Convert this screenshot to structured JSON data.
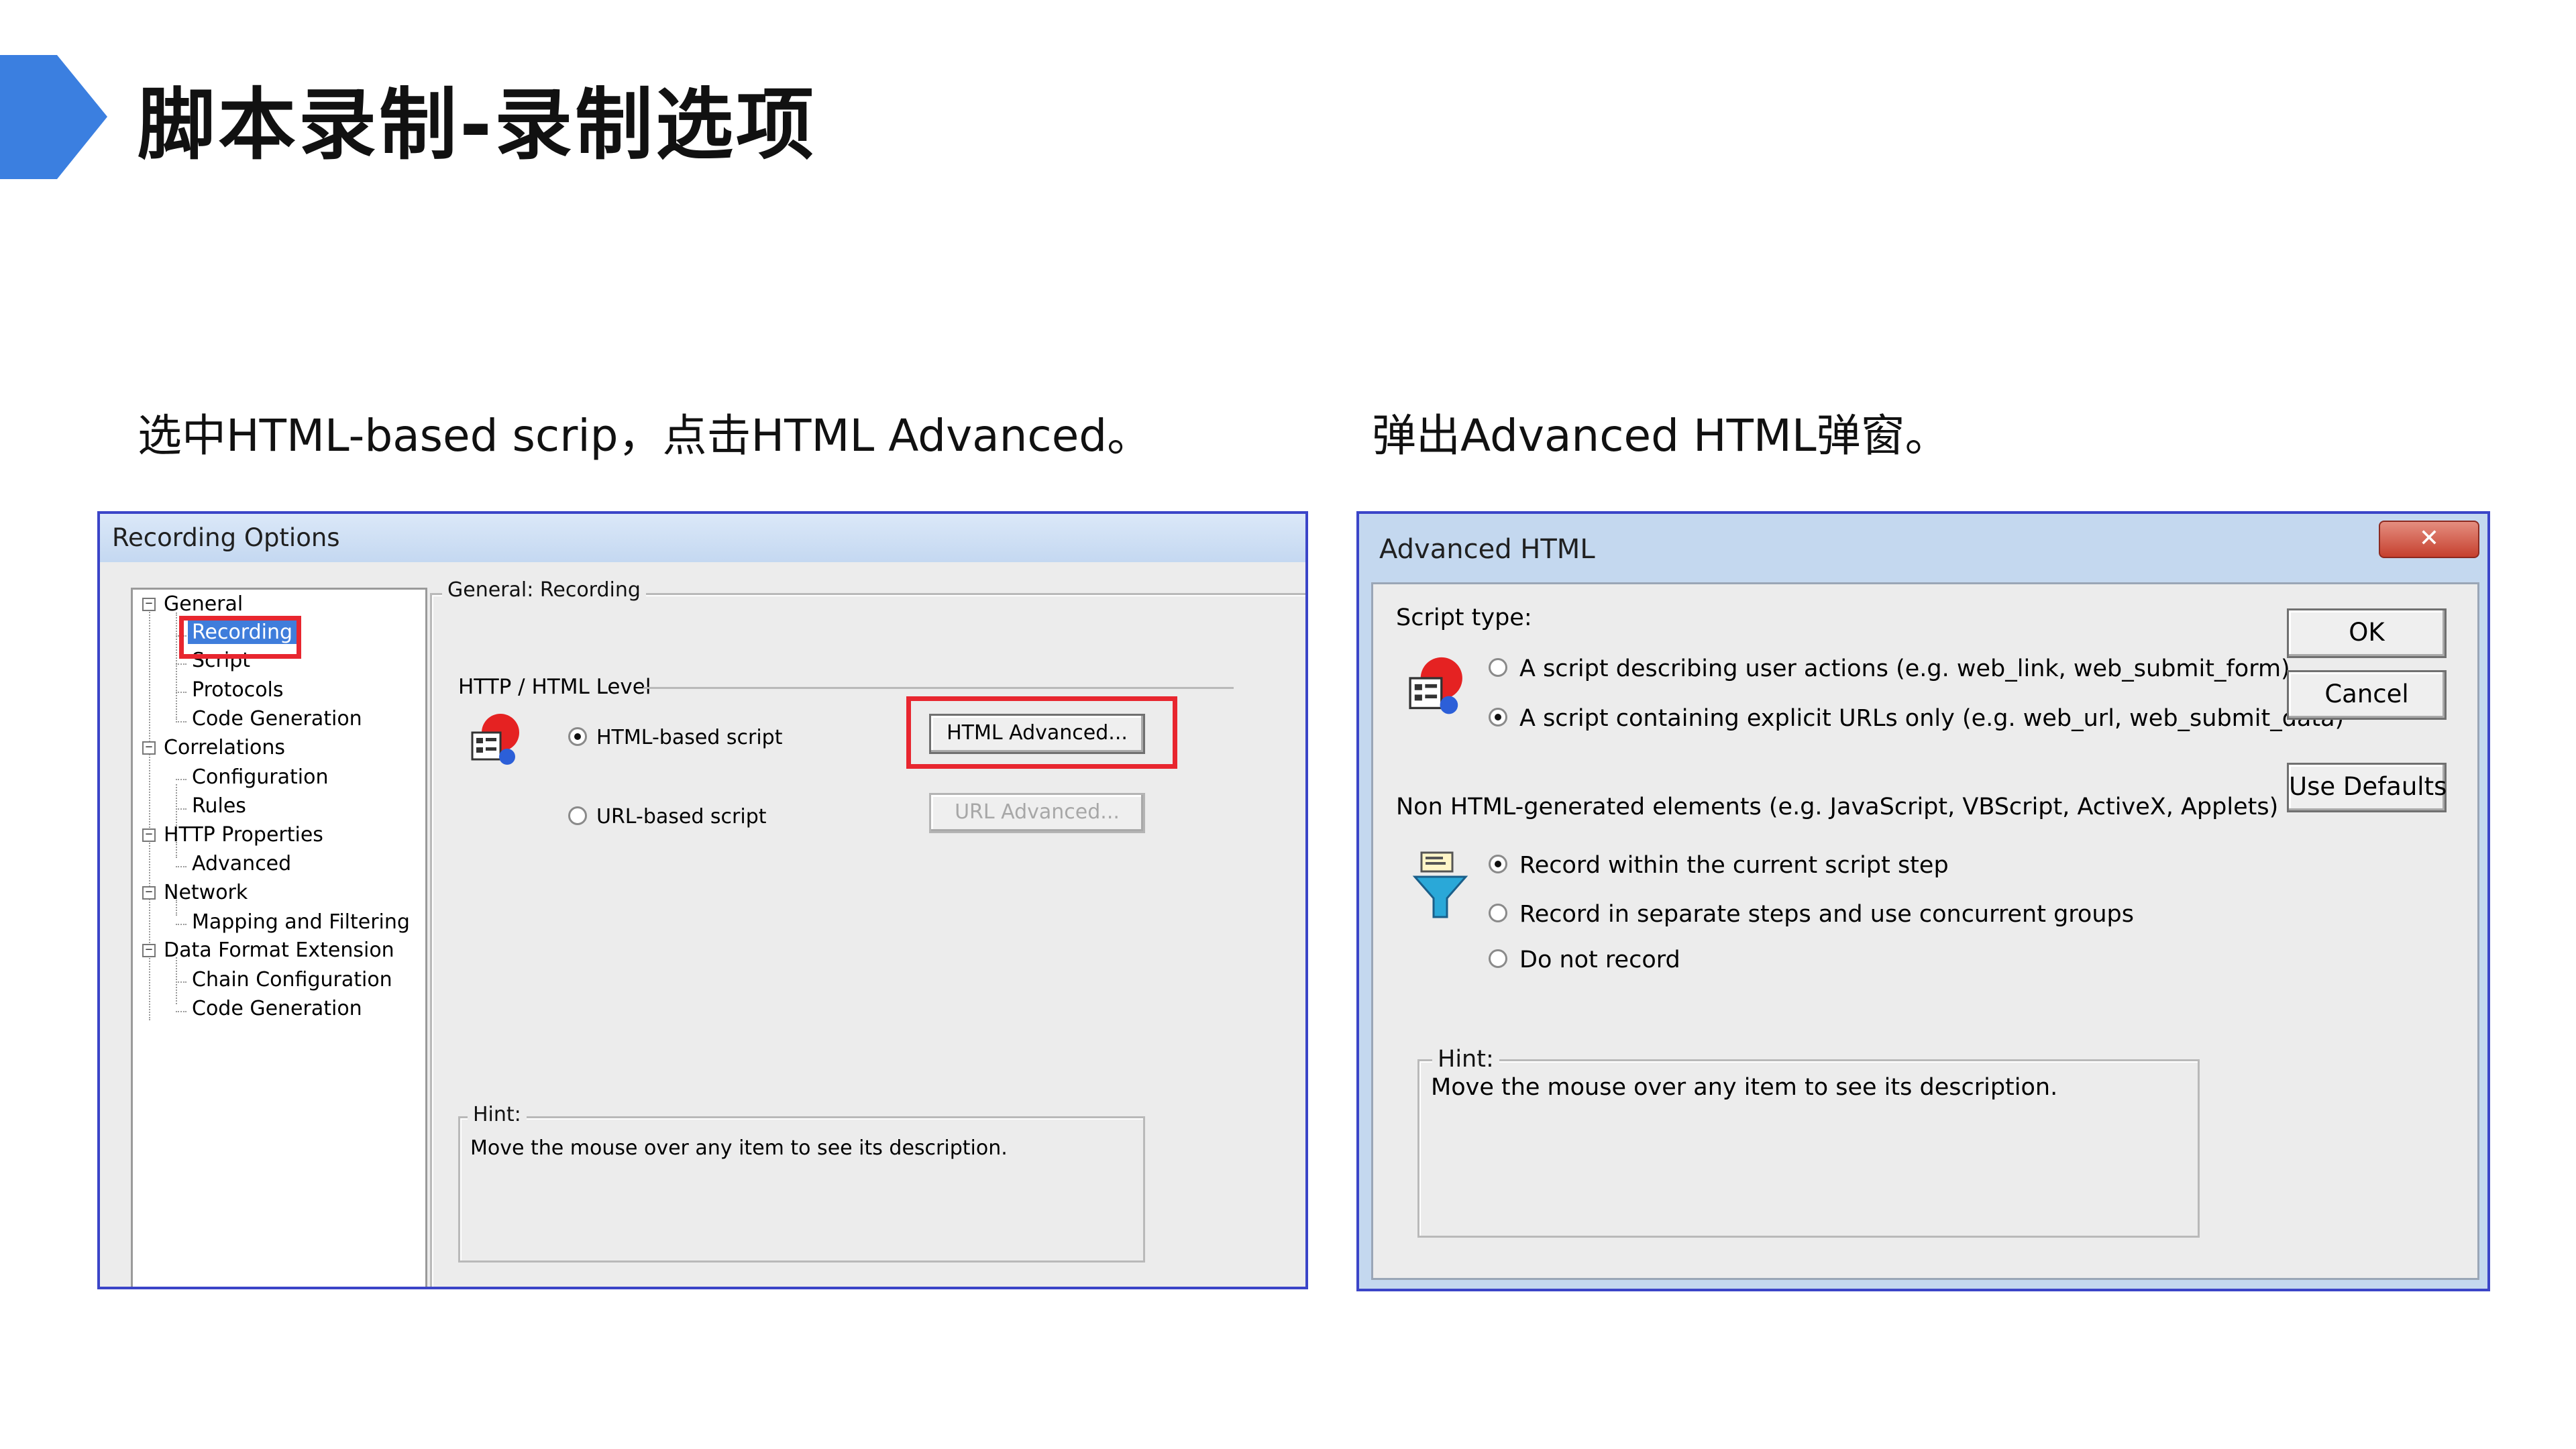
{
  "slide": {
    "title": "脚本录制-录制选项",
    "caption_left": "选中HTML-based scrip，点击HTML Advanced。",
    "caption_right": "弹出Advanced HTML弹窗。",
    "accent_color": "#3b7fe0"
  },
  "recording_options": {
    "title": "Recording Options",
    "tree": {
      "items": [
        {
          "label": "General",
          "level": 0,
          "expanded": true
        },
        {
          "label": "Recording",
          "level": 1,
          "selected": true
        },
        {
          "label": "Script",
          "level": 1
        },
        {
          "label": "Protocols",
          "level": 1
        },
        {
          "label": "Code Generation",
          "level": 1
        },
        {
          "label": "Correlations",
          "level": 0,
          "expanded": true
        },
        {
          "label": "Configuration",
          "level": 1
        },
        {
          "label": "Rules",
          "level": 1
        },
        {
          "label": "HTTP Properties",
          "level": 0,
          "expanded": true
        },
        {
          "label": "Advanced",
          "level": 1
        },
        {
          "label": "Network",
          "level": 0,
          "expanded": true
        },
        {
          "label": "Mapping and Filtering",
          "level": 1
        },
        {
          "label": "Data Format Extension",
          "level": 0,
          "expanded": true
        },
        {
          "label": "Chain Configuration",
          "level": 1
        },
        {
          "label": "Code Generation",
          "level": 1
        }
      ]
    },
    "section_title": "General: Recording",
    "level_label": "HTTP / HTML Level",
    "html_based_label": "HTML-based script",
    "url_based_label": "URL-based script",
    "html_advanced_button": "HTML Advanced...",
    "url_advanced_button": "URL Advanced...",
    "hint_label": "Hint:",
    "hint_text": "Move the mouse over any item to see its description."
  },
  "advanced_html": {
    "title": "Advanced HTML",
    "close_label": "✕",
    "script_type_label": "Script type:",
    "option_user_actions": "A script describing user actions (e.g. web_link, web_submit_form)",
    "option_explicit_urls": "A script containing explicit URLs only (e.g. web_url, web_submit_data)",
    "non_html_label": "Non HTML-generated elements (e.g. JavaScript, VBScript, ActiveX, Applets)",
    "option_record_current": "Record within the current script step",
    "option_record_separate": "Record in separate steps and use concurrent groups",
    "option_do_not_record": "Do not record",
    "hint_label": "Hint:",
    "hint_text": "Move the mouse over any item to see its description.",
    "ok_button": "OK",
    "cancel_button": "Cancel",
    "defaults_button": "Use Defaults"
  }
}
